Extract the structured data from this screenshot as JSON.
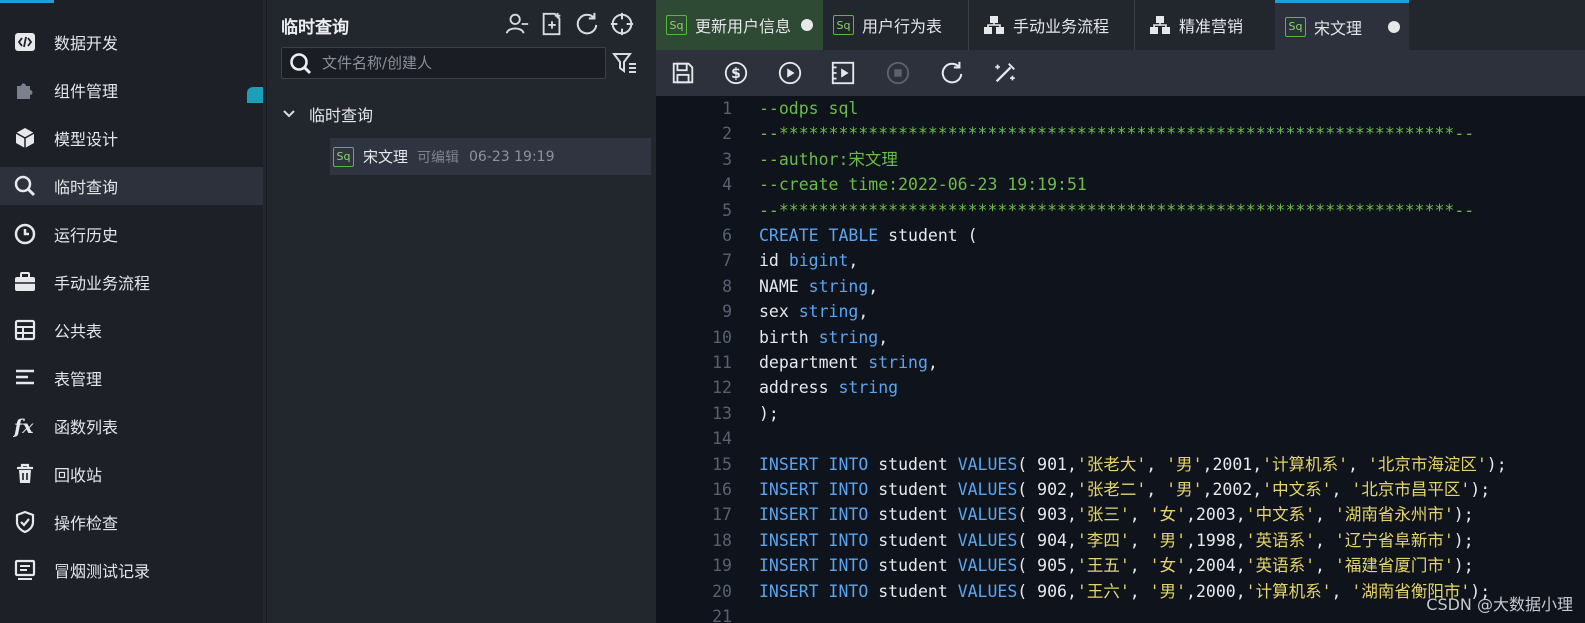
{
  "sidebar": {
    "items": [
      {
        "label": "数据开发",
        "icon": "code-icon"
      },
      {
        "label": "组件管理",
        "icon": "puzzle-icon"
      },
      {
        "label": "模型设计",
        "icon": "cube-icon"
      },
      {
        "label": "临时查询",
        "icon": "search-icon"
      },
      {
        "label": "运行历史",
        "icon": "clock-icon"
      },
      {
        "label": "手动业务流程",
        "icon": "briefcase-icon"
      },
      {
        "label": "公共表",
        "icon": "table-icon"
      },
      {
        "label": "表管理",
        "icon": "list-icon"
      },
      {
        "label": "函数列表",
        "icon": "function-icon"
      },
      {
        "label": "回收站",
        "icon": "trash-icon"
      },
      {
        "label": "操作检查",
        "icon": "shield-icon"
      },
      {
        "label": "冒烟测试记录",
        "icon": "monitor-icon"
      }
    ],
    "active_index": 3
  },
  "file_panel": {
    "title": "临时查询",
    "search_placeholder": "文件名称/创建人",
    "folder": "临时查询",
    "file": {
      "badge": "Sq",
      "name": "宋文理",
      "status": "可编辑",
      "time": "06-23 19:19"
    }
  },
  "tabs": [
    {
      "badge": "Sq",
      "label": "更新用户信息",
      "unsaved": true
    },
    {
      "badge": "Sq",
      "label": "用户行为表",
      "unsaved": false
    },
    {
      "label": "手动业务流程",
      "icon": "workflow-icon"
    },
    {
      "label": "精准营销",
      "icon": "workflow-icon"
    },
    {
      "badge": "Sq",
      "label": "宋文理",
      "unsaved": true
    }
  ],
  "toolbar": [
    "save-icon",
    "cost-icon",
    "run-icon",
    "run-params-icon",
    "stop-icon",
    "refresh-icon",
    "format-icon"
  ],
  "code_lines": [
    {
      "n": "1",
      "tokens": [
        [
          "c",
          "--odps sql"
        ]
      ]
    },
    {
      "n": "2",
      "tokens": [
        [
          "c",
          "--********************************************************************--"
        ]
      ]
    },
    {
      "n": "3",
      "tokens": [
        [
          "c",
          "--author:宋文理"
        ]
      ]
    },
    {
      "n": "4",
      "tokens": [
        [
          "c",
          "--create time:2022-06-23 19:19:51"
        ]
      ]
    },
    {
      "n": "5",
      "tokens": [
        [
          "c",
          "--********************************************************************--"
        ]
      ]
    },
    {
      "n": "6",
      "tokens": [
        [
          "k",
          "CREATE TABLE"
        ],
        [
          "p",
          " student ("
        ]
      ]
    },
    {
      "n": "7",
      "tokens": [
        [
          "p",
          "id "
        ],
        [
          "k",
          "bigint"
        ],
        [
          "p",
          ","
        ]
      ]
    },
    {
      "n": "8",
      "tokens": [
        [
          "p",
          "NAME "
        ],
        [
          "k",
          "string"
        ],
        [
          "p",
          ","
        ]
      ]
    },
    {
      "n": "9",
      "tokens": [
        [
          "p",
          "sex "
        ],
        [
          "k",
          "string"
        ],
        [
          "p",
          ","
        ]
      ]
    },
    {
      "n": "10",
      "tokens": [
        [
          "p",
          "birth "
        ],
        [
          "k",
          "string"
        ],
        [
          "p",
          ","
        ]
      ]
    },
    {
      "n": "11",
      "tokens": [
        [
          "p",
          "department "
        ],
        [
          "k",
          "string"
        ],
        [
          "p",
          ","
        ]
      ]
    },
    {
      "n": "12",
      "tokens": [
        [
          "p",
          "address "
        ],
        [
          "k",
          "string"
        ]
      ]
    },
    {
      "n": "13",
      "tokens": [
        [
          "p",
          ");"
        ]
      ]
    },
    {
      "n": "14",
      "tokens": []
    },
    {
      "n": "15",
      "tokens": [
        [
          "k",
          "INSERT INTO"
        ],
        [
          "p",
          " student "
        ],
        [
          "k",
          "VALUES"
        ],
        [
          "p",
          "( 901,"
        ],
        [
          "s",
          "'张老大'"
        ],
        [
          "p",
          ", "
        ],
        [
          "s",
          "'男'"
        ],
        [
          "p",
          ",2001,"
        ],
        [
          "s",
          "'计算机系'"
        ],
        [
          "p",
          ", "
        ],
        [
          "s",
          "'北京市海淀区'"
        ],
        [
          "p",
          ");"
        ]
      ]
    },
    {
      "n": "16",
      "tokens": [
        [
          "k",
          "INSERT INTO"
        ],
        [
          "p",
          " student "
        ],
        [
          "k",
          "VALUES"
        ],
        [
          "p",
          "( 902,"
        ],
        [
          "s",
          "'张老二'"
        ],
        [
          "p",
          ", "
        ],
        [
          "s",
          "'男'"
        ],
        [
          "p",
          ",2002,"
        ],
        [
          "s",
          "'中文系'"
        ],
        [
          "p",
          ", "
        ],
        [
          "s",
          "'北京市昌平区'"
        ],
        [
          "p",
          ");"
        ]
      ]
    },
    {
      "n": "17",
      "tokens": [
        [
          "k",
          "INSERT INTO"
        ],
        [
          "p",
          " student "
        ],
        [
          "k",
          "VALUES"
        ],
        [
          "p",
          "( 903,"
        ],
        [
          "s",
          "'张三'"
        ],
        [
          "p",
          ", "
        ],
        [
          "s",
          "'女'"
        ],
        [
          "p",
          ",2003,"
        ],
        [
          "s",
          "'中文系'"
        ],
        [
          "p",
          ", "
        ],
        [
          "s",
          "'湖南省永州市'"
        ],
        [
          "p",
          ");"
        ]
      ]
    },
    {
      "n": "18",
      "tokens": [
        [
          "k",
          "INSERT INTO"
        ],
        [
          "p",
          " student "
        ],
        [
          "k",
          "VALUES"
        ],
        [
          "p",
          "( 904,"
        ],
        [
          "s",
          "'李四'"
        ],
        [
          "p",
          ", "
        ],
        [
          "s",
          "'男'"
        ],
        [
          "p",
          ",1998,"
        ],
        [
          "s",
          "'英语系'"
        ],
        [
          "p",
          ", "
        ],
        [
          "s",
          "'辽宁省阜新市'"
        ],
        [
          "p",
          ");"
        ]
      ]
    },
    {
      "n": "19",
      "tokens": [
        [
          "k",
          "INSERT INTO"
        ],
        [
          "p",
          " student "
        ],
        [
          "k",
          "VALUES"
        ],
        [
          "p",
          "( 905,"
        ],
        [
          "s",
          "'王五'"
        ],
        [
          "p",
          ", "
        ],
        [
          "s",
          "'女'"
        ],
        [
          "p",
          ",2004,"
        ],
        [
          "s",
          "'英语系'"
        ],
        [
          "p",
          ", "
        ],
        [
          "s",
          "'福建省厦门市'"
        ],
        [
          "p",
          ");"
        ]
      ]
    },
    {
      "n": "20",
      "tokens": [
        [
          "k",
          "INSERT INTO"
        ],
        [
          "p",
          " student "
        ],
        [
          "k",
          "VALUES"
        ],
        [
          "p",
          "( 906,"
        ],
        [
          "s",
          "'王六'"
        ],
        [
          "p",
          ", "
        ],
        [
          "s",
          "'男'"
        ],
        [
          "p",
          ",2000,"
        ],
        [
          "s",
          "'计算机系'"
        ],
        [
          "p",
          ", "
        ],
        [
          "s",
          "'湖南省衡阳市'"
        ],
        [
          "p",
          ");"
        ]
      ]
    },
    {
      "n": "21",
      "tokens": []
    }
  ],
  "watermark": "CSDN @大数据小理"
}
